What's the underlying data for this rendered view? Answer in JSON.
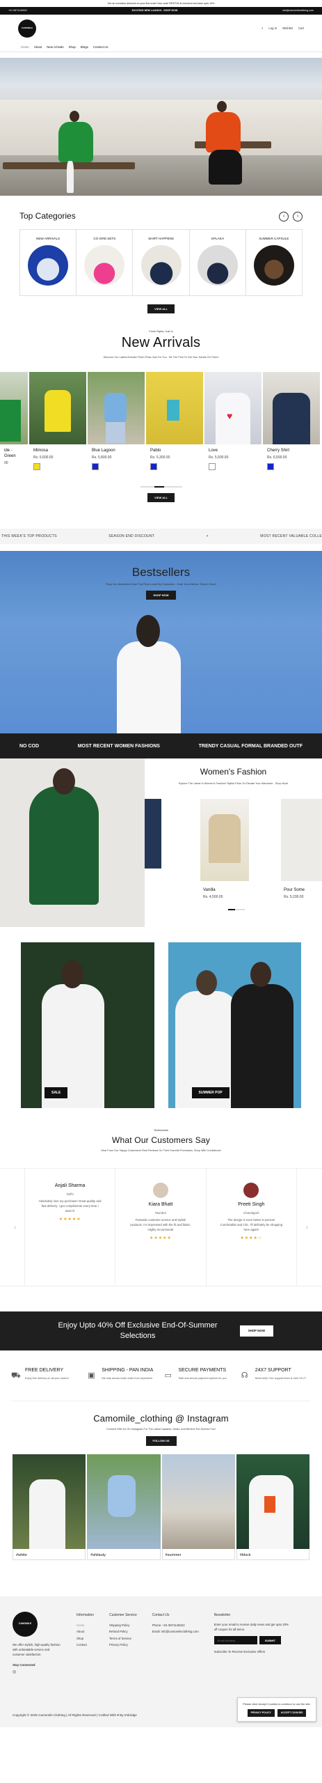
{
  "announcement": "Get an exclusive discount on your first order! Use code FIRST15 at checkout and save upto 15%",
  "infobar": {
    "phone": "+91 9871145022",
    "launch": "EXCITING NEW LAUNCH - SHOP NOW",
    "email": "info@camomileclothing.com"
  },
  "header": {
    "logo": "CAMOMILE",
    "login": "Log in",
    "wishlist": "Wishlist",
    "cart": "Cart"
  },
  "nav": [
    "Home",
    "About",
    "New Arrivals",
    "Shop",
    "Blogs",
    "Contact Us"
  ],
  "top_categories": {
    "title": "Top Categories",
    "items": [
      "NEW ARRIVALS",
      "CO-ORD SETS",
      "SHIRT HAPPENS",
      "SPLASH",
      "SUMMER CAPSULE"
    ],
    "view_all": "VIEW ALL"
  },
  "new_arrivals": {
    "kicker": "Fresh Styles, Just In",
    "title": "New Arrivals",
    "subtitle": "Discover Our Latest Arrivals! Fresh Picks Just For You - Be The First To Get Your Hands On Them!",
    "products": [
      {
        "name": "ide - Green",
        "price": "00",
        "swatch": "#1f7a3a"
      },
      {
        "name": "Mimosa",
        "price": "Rs. 6,500.00",
        "swatch": "#f2de1e"
      },
      {
        "name": "Blue Lagoon",
        "price": "Rs. 5,800.00",
        "swatch": "#1526c9"
      },
      {
        "name": "Pablo",
        "price": "Rs. 5,300.00",
        "swatch": "#1526c9"
      },
      {
        "name": "Love",
        "price": "Rs. 5,500.00",
        "swatch": "#ffffff"
      },
      {
        "name": "Cherry Shirt",
        "price": "Rs. 6,500.00",
        "swatch": "#1526c9"
      }
    ],
    "view_all": "VIEW ALL"
  },
  "marquee": [
    "THIS WEEK'S TOP PRODUCTS",
    "SEASON END DISCOUNT",
    "+",
    "MOST RECENT VALUABLE COLLE"
  ],
  "bestsellers": {
    "title": "Bestsellers",
    "subtitle": "Shop Our Bestsellers Now! Top Picks Loved By Customers - Grab Yours Before They're Gone!",
    "cta": "SHOP NOW"
  },
  "ticker": [
    "NO COD",
    "MOST RECENT WOMEN FASHIONS",
    "TRENDY CASUAL FORMAL BRANDED OUTF"
  ],
  "womens": {
    "title": "Women's Fashion",
    "subtitle": "Explore The Latest In Women's Fashion! Stylish Picks To Elevate Your Wardrobe - Shop Now!",
    "items": [
      {
        "name": "Vanilla",
        "price": "Rs. 4,500.00"
      },
      {
        "name": "Pour Some",
        "price": "Rs. 5,200.00"
      }
    ]
  },
  "promo_tiles": [
    {
      "label": "SALE"
    },
    {
      "label": "SUMMER POP"
    }
  ],
  "testimonials": {
    "kicker": "Testimonials",
    "title": "What Our Customers Say",
    "subtitle": "Hear From Our Happy Customers! Real Reviews On Their Favorite Purchases. Shop With Confidence!",
    "items": [
      {
        "name": "Anjali Sharma",
        "city": "Delhi",
        "text": "Absolutely love my purchase! Great quality and fast delivery. I get compliments every time I wear it!",
        "stars": "★★★★★"
      },
      {
        "name": "Kiara Bhatt",
        "city": "Mumbai",
        "text": "Fantastic customer service and stylish products. I'm impressed with the fit and fabric. Highly recommend!",
        "stars": "★★★★★"
      },
      {
        "name": "Preeti Singh",
        "city": "Chandigarh",
        "text": "The design is even better in person! Comfortable and chic. I'll definitely be shopping here again!",
        "stars": "★★★★☆"
      }
    ]
  },
  "end_sale": {
    "text": "Enjoy Upto 40% Off Exclusive End-Of-Summer Selections",
    "cta": "SHOP NOW"
  },
  "features": [
    {
      "title": "FREE DELIVERY",
      "text": "Enjoy free delivery on all your orders!",
      "icon": "truck-icon"
    },
    {
      "title": "SHIPPING - PAN INDIA",
      "text": "We ship across India under from anywhere!",
      "icon": "box-icon"
    },
    {
      "title": "SECURE PAYMENTS",
      "text": "Safe and secure payment options for you",
      "icon": "card-icon"
    },
    {
      "title": "24X7 SUPPORT",
      "text": "Need help? Our support team is here 24×7!",
      "icon": "headset-icon"
    }
  ],
  "instagram": {
    "title": "Camomile_clothing @ Instagram",
    "subtitle": "Connect With Us On Instagram For The Latest Updates, Deals, And Behind-The-Scenes Fun!",
    "cta": "FOLLOW US",
    "tags": [
      "#white",
      "#shilauty",
      "#summer",
      "#block"
    ]
  },
  "footer": {
    "about": "We offer stylish, high-quality fashion with unbeatable service and customer satisfaction.",
    "stay": "Stay Connected",
    "info_title": "Information",
    "info": [
      "Home",
      "About",
      "Shop",
      "Contact"
    ],
    "service_title": "Customer Service",
    "service": [
      "Shipping Policy",
      "Refund Policy",
      "Terms of Service",
      "Privacy Policy"
    ],
    "contact_title": "Contact Us",
    "phone": "Phone: +91 9871145022",
    "email": "Email: info@camomileclothing.com",
    "news_title": "Newsletter",
    "news_text": "Enter your email to receive daily news and get upto 20% off coupon for all items.",
    "email_placeholder": "Email Address",
    "submit": "SUBMIT",
    "subscribe": "Subscribe To Receive Exclusive Offers",
    "copyright": "Copyright © 2025 Camomile Clothing | All Rights Reserved | Crafted With ♥ By Imbridge"
  },
  "cookie": {
    "text": "Please click Accept Cookies to continue to use the site.",
    "privacy": "PRIVACY POLICY",
    "accept": "ACCEPT COOKIES"
  }
}
